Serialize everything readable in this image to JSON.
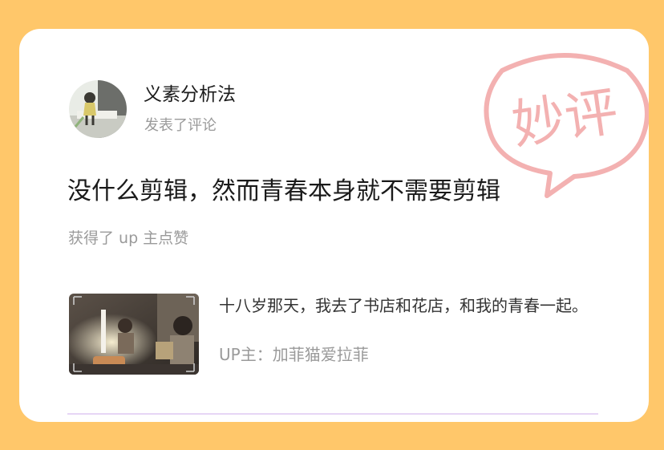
{
  "stamp": {
    "text": "妙评",
    "color": "#f08a8a"
  },
  "user": {
    "name": "义素分析法",
    "action": "发表了评论"
  },
  "comment": {
    "text": "没什么剪辑，然而青春本身就不需要剪辑"
  },
  "liked_by_up": "获得了 up 主点赞",
  "video": {
    "title": "十八岁那天，我去了书店和花店，和我的青春一起。",
    "uploader": "UP主：加菲猫爱拉菲"
  },
  "colors": {
    "background": "#ffc76a",
    "card": "#ffffff",
    "divider": "#e7d6f5"
  }
}
